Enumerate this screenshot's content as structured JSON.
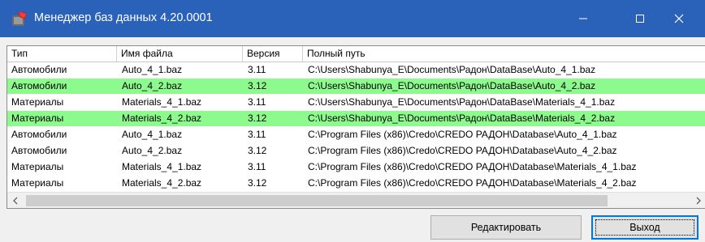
{
  "window": {
    "title": "Менеджер баз данных 4.20.0001",
    "titlebar_color": "#2a62ba"
  },
  "table": {
    "columns": [
      "Тип",
      "Имя файла",
      "Версия",
      "Полный путь"
    ],
    "rows": [
      {
        "type": "Автомобили",
        "file": "Auto_4_1.baz",
        "version": "3.11",
        "path": "C:\\Users\\Shabunya_E\\Documents\\Радон\\DataBase\\Auto_4_1.baz",
        "highlighted": false
      },
      {
        "type": "Автомобили",
        "file": "Auto_4_2.baz",
        "version": "3.12",
        "path": "C:\\Users\\Shabunya_E\\Documents\\Радон\\DataBase\\Auto_4_2.baz",
        "highlighted": true
      },
      {
        "type": "Материалы",
        "file": "Materials_4_1.baz",
        "version": "3.11",
        "path": "C:\\Users\\Shabunya_E\\Documents\\Радон\\DataBase\\Materials_4_1.baz",
        "highlighted": false
      },
      {
        "type": "Материалы",
        "file": "Materials_4_2.baz",
        "version": "3.12",
        "path": "C:\\Users\\Shabunya_E\\Documents\\Радон\\DataBase\\Materials_4_2.baz",
        "highlighted": true
      },
      {
        "type": "Автомобили",
        "file": "Auto_4_1.baz",
        "version": "3.11",
        "path": "C:\\Program Files (x86)\\Credo\\CREDO РАДОН\\Database\\Auto_4_1.baz",
        "highlighted": false
      },
      {
        "type": "Автомобили",
        "file": "Auto_4_2.baz",
        "version": "3.12",
        "path": "C:\\Program Files (x86)\\Credo\\CREDO РАДОН\\Database\\Auto_4_2.baz",
        "highlighted": false
      },
      {
        "type": "Материалы",
        "file": "Materials_4_1.baz",
        "version": "3.11",
        "path": "C:\\Program Files (x86)\\Credo\\CREDO РАДОН\\Database\\Materials_4_1.baz",
        "highlighted": false
      },
      {
        "type": "Материалы",
        "file": "Materials_4_2.baz",
        "version": "3.12",
        "path": "C:\\Program Files (x86)\\Credo\\CREDO РАДОН\\Database\\Materials_4_2.baz",
        "highlighted": false
      }
    ],
    "highlight_color": "#8dfa8d"
  },
  "buttons": {
    "edit_label": "Редактировать",
    "exit_label": "Выход"
  },
  "icons": {
    "app": "database-app-icon",
    "minimize": "minimize-icon",
    "maximize": "maximize-icon",
    "close": "close-icon",
    "scroll_left": "chevron-left-icon",
    "scroll_right": "chevron-right-icon"
  }
}
